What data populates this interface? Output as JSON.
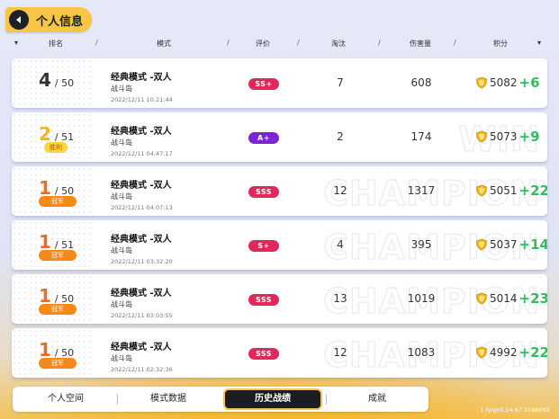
{
  "header": {
    "title": "个人信息"
  },
  "columns": {
    "rank": "排名",
    "mode": "模式",
    "grade": "评价",
    "elim": "淘汰",
    "damage": "伤害量",
    "score": "积分"
  },
  "colors": {
    "accent": "#f6c644",
    "grade_red": "#e0285a",
    "grade_purple": "#7b24d6",
    "delta_green": "#2fbe5c",
    "champion_orange": "#f58a1a"
  },
  "rows": [
    {
      "rank": "4",
      "total": "/ 50",
      "badge": "",
      "mode": "经典模式 -双人",
      "map": "战斗岛",
      "time": "2022/12/11 10:21:44",
      "grade": "SS+",
      "elim": "7",
      "damage": "608",
      "score": "5082",
      "delta": "+6",
      "watermark": ""
    },
    {
      "rank": "2",
      "total": "/ 51",
      "badge": "胜利",
      "mode": "经典模式 -双人",
      "map": "战斗岛",
      "time": "2022/12/11 04:47:17",
      "grade": "A+",
      "elim": "2",
      "damage": "174",
      "score": "5073",
      "delta": "+9",
      "watermark": "WIN"
    },
    {
      "rank": "1",
      "total": "/ 50",
      "badge": "冠军",
      "mode": "经典模式 -双人",
      "map": "战斗岛",
      "time": "2022/12/11 04:07:13",
      "grade": "SSS",
      "elim": "12",
      "damage": "1317",
      "score": "5051",
      "delta": "+22",
      "watermark": "CHAMPION"
    },
    {
      "rank": "1",
      "total": "/ 51",
      "badge": "冠军",
      "mode": "经典模式 -双人",
      "map": "战斗岛",
      "time": "2022/12/11 03:32:20",
      "grade": "S+",
      "elim": "4",
      "damage": "395",
      "score": "5037",
      "delta": "+14",
      "watermark": "CHAMPION"
    },
    {
      "rank": "1",
      "total": "/ 50",
      "badge": "冠军",
      "mode": "经典模式 -双人",
      "map": "战斗岛",
      "time": "2022/12/11 03:03:55",
      "grade": "SSS",
      "elim": "13",
      "damage": "1019",
      "score": "5014",
      "delta": "+23",
      "watermark": "CHAMPION"
    },
    {
      "rank": "1",
      "total": "/ 50",
      "badge": "冠军",
      "mode": "经典模式 -双人",
      "map": "战斗岛",
      "time": "2022/12/11 02:32:36",
      "grade": "SSS",
      "elim": "12",
      "damage": "1083",
      "score": "4992",
      "delta": "+22",
      "watermark": "CHAMPION"
    }
  ],
  "tabs": [
    {
      "label": "个人空间"
    },
    {
      "label": "模式数据"
    },
    {
      "label": "历史战绩"
    },
    {
      "label": "成就"
    }
  ],
  "footer": {
    "id_text": "1.fyignil.14.67.1586092"
  },
  "icons": {
    "back": "back-arrow-icon",
    "score": "shield-icon"
  }
}
